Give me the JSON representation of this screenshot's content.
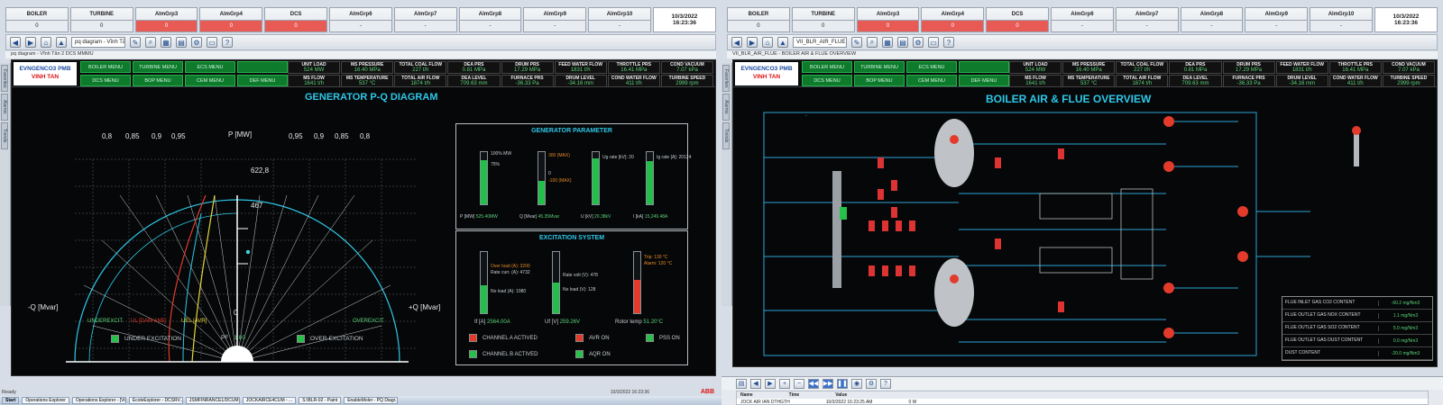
{
  "status_bar": {
    "boxes": [
      {
        "title": "BOILER",
        "value": "0"
      },
      {
        "title": "TURBINE",
        "value": "0"
      },
      {
        "title": "AlmGrp3",
        "value": "0"
      },
      {
        "title": "AlmGrp4",
        "value": "0"
      },
      {
        "title": "DCS",
        "value": "0"
      },
      {
        "title": "AlmGrp6",
        "value": "-"
      },
      {
        "title": "AlmGrp7",
        "value": "-"
      },
      {
        "title": "AlmGrp8",
        "value": "-"
      },
      {
        "title": "AlmGrp9",
        "value": "-"
      },
      {
        "title": "AlmGrp10",
        "value": "-"
      }
    ],
    "date": "10/3/2022",
    "time": "16:23:36"
  },
  "left": {
    "address": "pq diagram - Vĩnh Tân 2 DCS MMMU",
    "crumb": "pq diagram - Vĩnh Tân 2 DCS MMMU",
    "side_tabs": [
      "Favorites",
      "Alarms",
      "Trends"
    ],
    "title": "GENERATOR P-Q DIAGRAM",
    "pq": {
      "p_axis": "P [MW]",
      "q_left": "-Q [Mvar]",
      "q_right": "+Q [Mvar]",
      "origin": "0",
      "pf_left": [
        "0,8",
        "0,85",
        "0,9",
        "0,95"
      ],
      "pf_right": [
        "0,95",
        "0,9",
        "0,85",
        "0,8"
      ],
      "p_marks": [
        "622,8",
        "467"
      ],
      "under_label": "UNDEREXCIT.",
      "ul_label": "UL [DAM AN5]",
      "uel_label": "UEL [AVR]",
      "over_label": "OVEREXCIT."
    },
    "legend": {
      "under": "UNDER EXCITATION",
      "pf_label": "PF",
      "pf_value": "1.00",
      "over": "OVER-EXCITATION"
    },
    "gen_param": {
      "title": "GENERATOR PARAMETER",
      "bars": [
        {
          "label": "P [MW]",
          "value": "525.40MW",
          "fill": 0.85,
          "marks": [
            "100% MW",
            "75%"
          ]
        },
        {
          "label": "Q [Mvar]",
          "value": "45.35Mvar",
          "fill": 0.45,
          "marks": [
            "300 (MAX)",
            "0",
            "-100 (MAX)"
          ]
        },
        {
          "label": "U [kV]",
          "value": "20.38kV",
          "fill": 0.88,
          "marks": [
            "Ug rate [kV]: 20"
          ]
        },
        {
          "label": "I [kA]",
          "value": "15,249.48A",
          "fill": 0.82,
          "marks": [
            "Ig rate [A]: 20124"
          ]
        }
      ]
    },
    "excitation": {
      "title": "EXCITATION SYSTEM",
      "bars": [
        {
          "label": "If [A]",
          "value": "2564.00A",
          "fill": 0.45,
          "marks": [
            "Over load (A): 3200",
            "Rate curr. (A): 4732",
            "No load (A): 1980"
          ]
        },
        {
          "label": "Uf [V]",
          "value": "259.26V",
          "fill": 0.5,
          "marks": [
            "Rate volt (V): 478",
            "No load (V): 128"
          ]
        },
        {
          "label": "Rotor temp",
          "value": "51.20°C",
          "fill": 0.55,
          "marks": [
            "Trip: 130 °C",
            "Alarm: 120 °C"
          ]
        }
      ],
      "leds": [
        {
          "label": "CHANNEL A ACTIVED",
          "color": "#e23b2b"
        },
        {
          "label": "AVR ON",
          "color": "#e23b2b"
        },
        {
          "label": "PSS ON",
          "color": "#27c04a"
        },
        {
          "label": "CHANNEL B ACTIVED",
          "color": "#27c04a"
        },
        {
          "label": "AQR ON",
          "color": "#27c04a"
        }
      ]
    },
    "ready": "Ready",
    "status_right": "10/3/2022 16:23:36",
    "footer_logo": "ABB"
  },
  "right": {
    "address": "VII_BLR_AIR_FLUE",
    "crumb": "VII_BLR_AIR_FLUE - BOILER AIR & FLUE OVERVIEW",
    "side_tabs": [
      "Favorites",
      "Alarms",
      "Trends"
    ],
    "title": "BOILER AIR & FLUE OVERVIEW",
    "events": {
      "headers": [
        "Name",
        "Time",
        "Value"
      ],
      "row": [
        "JOCK AIR IAN DTHGTH",
        "10/3/2022 16:23:25 AM",
        "0 W"
      ]
    },
    "table_rows": [
      {
        "label": "FLUE INLET GAS CO2 CONTENT",
        "value": "-60.2 mg/Nm3"
      },
      {
        "label": "FLUE OUTLET GAS NOX CONTENT",
        "value": "1.1 mg/Nm3"
      },
      {
        "label": "FLUE OUTLET GAS SO2 CONTENT",
        "value": "5.0 mg/Nm3"
      },
      {
        "label": "FLUE OUTLET GAS DUST CONTENT",
        "value": "0.0 mg/Nm3"
      },
      {
        "label": "DUST CONTENT",
        "value": "-20.0 mg/Nm3"
      }
    ]
  },
  "header": {
    "logo_line1": "EVNGENCO3 PMB",
    "logo_line2": "VINH TAN",
    "nav": [
      "BOILER MENU",
      "TURBINE MENU",
      "ECS MENU",
      "",
      "DCS MENU",
      "BOP MENU",
      "CEM MENU",
      "DEF MENU"
    ],
    "kpis": [
      {
        "label": "UNIT LOAD",
        "value": "524 MW"
      },
      {
        "label": "MS PRESSURE",
        "value": "16.40 MPa"
      },
      {
        "label": "TOTAL COAL FLOW",
        "value": "227 t/h"
      },
      {
        "label": "DEA PRS",
        "value": "0.81 MPa"
      },
      {
        "label": "DRUM PRS",
        "value": "17.29 MPa"
      },
      {
        "label": "FEED WATER FLOW",
        "value": "1831 t/h"
      },
      {
        "label": "THROTTLE PRS",
        "value": "16.41 MPa"
      },
      {
        "label": "COND VACUUM",
        "value": "7.07 kPa"
      },
      {
        "label": "MS FLOW",
        "value": "1641 t/h"
      },
      {
        "label": "MS TEMPERATURE",
        "value": "537 °C"
      },
      {
        "label": "TOTAL AIR FLOW",
        "value": "1874 t/h"
      },
      {
        "label": "DEA LEVEL",
        "value": "709.63 mm"
      },
      {
        "label": "FURNACE PRS",
        "value": "-36.33 Pa"
      },
      {
        "label": "DRUM LEVEL",
        "value": "-34.16 mm"
      },
      {
        "label": "COND WATER FLOW",
        "value": "411 t/h"
      },
      {
        "label": "TURBINE SPEED",
        "value": "2999 rpm"
      }
    ]
  },
  "taskbar": {
    "start": "Start",
    "tasks": [
      "Operations Explorer",
      "Operations Explorer - [Vin...",
      "EcoleExplorer - DCSRV...",
      "JSMFINRANCE1/DCUM...",
      "JOCKAIRCE4CUM - ...",
      "S:\\BLR-02 - Paint",
      "EnableMoler - PQ Diagr..."
    ],
    "clock": "4:23 PM",
    "logo": "ABB"
  },
  "colors": {
    "accent": "#2fc7e8",
    "green": "#27c04a",
    "red": "#e23b2b"
  }
}
